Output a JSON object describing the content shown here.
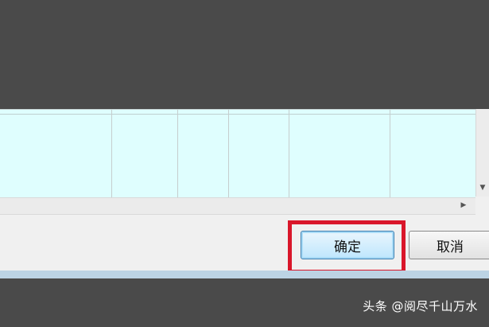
{
  "dialog": {
    "ok_label": "确定",
    "cancel_label": "取消"
  },
  "scrollbars": {
    "vertical_arrow_icon": "triangle-down-icon",
    "horizontal_arrow_icon": "triangle-right-icon"
  },
  "annotation": {
    "color": "#d9162a"
  },
  "watermark": {
    "text": "头条 @阅尽千山万水"
  }
}
